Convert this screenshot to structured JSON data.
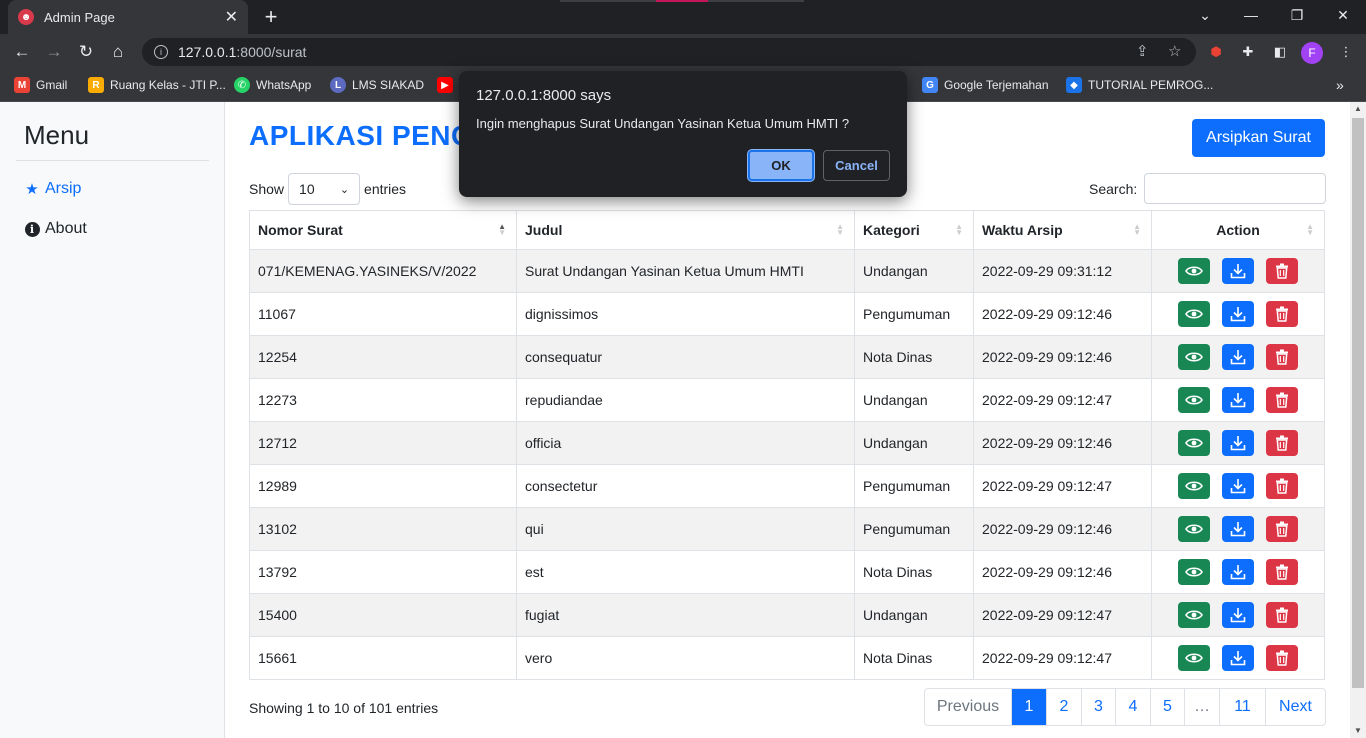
{
  "browser": {
    "tab_title": "Admin Page",
    "tab_favicon_letter": "ü",
    "url_host": "127.0.0.1",
    "url_rest": ":8000/surat",
    "profile_initial": "F",
    "bookmarks": [
      {
        "label": "Gmail",
        "color": "#ea4335",
        "letter": "M"
      },
      {
        "label": "Ruang Kelas - JTI P...",
        "color": "#f9ab00",
        "letter": "R"
      },
      {
        "label": "WhatsApp",
        "color": "#25d366",
        "letter": "W"
      },
      {
        "label": "LMS SIAKAD",
        "color": "#5c6bc0",
        "letter": "L"
      },
      {
        "label": "",
        "color": "#ff0000",
        "letter": "▶"
      },
      {
        "label": "Google Terjemahan",
        "color": "#4285f4",
        "letter": "G"
      },
      {
        "label": "TUTORIAL PEMROG...",
        "color": "#1a73e8",
        "letter": "◆"
      }
    ]
  },
  "sidebar": {
    "title": "Menu",
    "items": [
      {
        "label": "Arsip",
        "active": true
      },
      {
        "label": "About",
        "active": false
      }
    ]
  },
  "main": {
    "title": "APLIKASI PENG",
    "archive_button": "Arsipkan Surat",
    "show_label": "Show",
    "entries_value": "10",
    "entries_label": "entries",
    "search_label": "Search:"
  },
  "table": {
    "headers": [
      "Nomor Surat",
      "Judul",
      "Kategori",
      "Waktu Arsip",
      "Action"
    ],
    "rows": [
      [
        "071/KEMENAG.YASINEKS/V/2022",
        "Surat Undangan Yasinan Ketua Umum HMTI",
        "Undangan",
        "2022-09-29 09:31:12"
      ],
      [
        "11067",
        "dignissimos",
        "Pengumuman",
        "2022-09-29 09:12:46"
      ],
      [
        "12254",
        "consequatur",
        "Nota Dinas",
        "2022-09-29 09:12:46"
      ],
      [
        "12273",
        "repudiandae",
        "Undangan",
        "2022-09-29 09:12:47"
      ],
      [
        "12712",
        "officia",
        "Undangan",
        "2022-09-29 09:12:46"
      ],
      [
        "12989",
        "consectetur",
        "Pengumuman",
        "2022-09-29 09:12:47"
      ],
      [
        "13102",
        "qui",
        "Pengumuman",
        "2022-09-29 09:12:46"
      ],
      [
        "13792",
        "est",
        "Nota Dinas",
        "2022-09-29 09:12:46"
      ],
      [
        "15400",
        "fugiat",
        "Undangan",
        "2022-09-29 09:12:47"
      ],
      [
        "15661",
        "vero",
        "Nota Dinas",
        "2022-09-29 09:12:47"
      ]
    ]
  },
  "footer": {
    "info": "Showing 1 to 10 of 101 entries",
    "pages": [
      "Previous",
      "1",
      "2",
      "3",
      "4",
      "5",
      "…",
      "11",
      "Next"
    ]
  },
  "dialog": {
    "title": "127.0.0.1:8000 says",
    "message": "Ingin menghapus Surat Undangan Yasinan Ketua Umum HMTI ?",
    "ok": "OK",
    "cancel": "Cancel"
  },
  "colors": {
    "primary": "#0d6efd",
    "success": "#198754",
    "danger": "#dc3545"
  }
}
